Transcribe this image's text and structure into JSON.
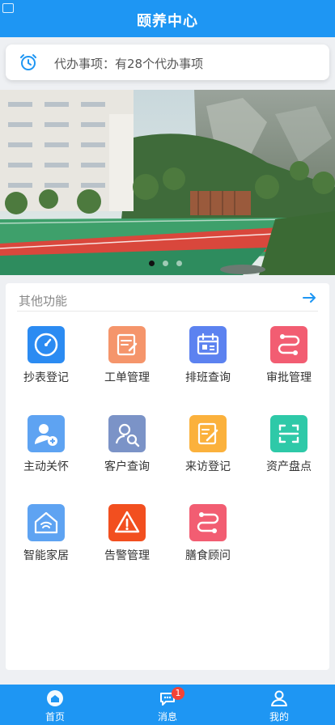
{
  "header": {
    "title": "颐养中心"
  },
  "todo": {
    "label": "代办事项：",
    "text": "有28个代办事项",
    "icon": "alarm-clock-icon"
  },
  "banner": {
    "slide_count": 3,
    "active_slide": 1
  },
  "functions": {
    "title": "其他功能",
    "items": [
      {
        "label": "抄表登记",
        "icon": "gauge-icon",
        "color": "#2b8bf2"
      },
      {
        "label": "工单管理",
        "icon": "work-order-icon",
        "color": "#f5956b"
      },
      {
        "label": "排班查询",
        "icon": "calendar-icon",
        "color": "#5c82f0"
      },
      {
        "label": "审批管理",
        "icon": "approval-flow-icon",
        "color": "#f25d72"
      },
      {
        "label": "主动关怀",
        "icon": "user-care-icon",
        "color": "#5ea3f2"
      },
      {
        "label": "客户查询",
        "icon": "customer-search-icon",
        "color": "#7b93c7"
      },
      {
        "label": "来访登记",
        "icon": "visitor-register-icon",
        "color": "#fbb13c"
      },
      {
        "label": "资产盘点",
        "icon": "scan-icon",
        "color": "#2ec9a8"
      },
      {
        "label": "智能家居",
        "icon": "smart-home-icon",
        "color": "#5ea3f2"
      },
      {
        "label": "告警管理",
        "icon": "warning-icon",
        "color": "#f24f1f"
      },
      {
        "label": "膳食顾问",
        "icon": "diet-flow-icon",
        "color": "#f25d72"
      }
    ]
  },
  "tabbar": {
    "items": [
      {
        "label": "首页",
        "icon": "home-icon"
      },
      {
        "label": "消息",
        "icon": "message-icon",
        "badge": "1"
      },
      {
        "label": "我的",
        "icon": "profile-icon"
      }
    ]
  },
  "colors": {
    "primary": "#1e96f3",
    "badge": "#f44336"
  }
}
